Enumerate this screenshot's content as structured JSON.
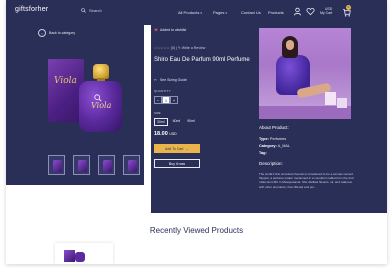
{
  "nav": {
    "logo": "giftsforher",
    "search_placeholder": "Search",
    "menu": [
      {
        "label": "All Products"
      },
      {
        "label": "Pages"
      },
      {
        "label": "Contact Us"
      },
      {
        "label": "Products"
      }
    ],
    "cart_currency": "USD",
    "cart_label": "My Cart",
    "cart_count": "0"
  },
  "product": {
    "back_label": "Back to category",
    "wishlist_label": "Added to wishlist",
    "rating_text": "(0)",
    "write_review": "Write a Review",
    "title": "Shiro Eau De Parfum 90ml Perfume",
    "size_guide": "See Sizing Guide",
    "quantity_label": "QUANTITY",
    "quantity_value": "1",
    "size_label": "SIZE",
    "sizes": [
      "30ml",
      "60ml",
      "90ml"
    ],
    "price": "18.00",
    "currency": "USD",
    "add_to_cart": "Add To Cart",
    "buy_now": "Buy it now",
    "box_text": "Viola",
    "bottle_text": "Viola"
  },
  "about": {
    "heading": "About Product:",
    "type_label": "Type:",
    "type_value": "Perfumes",
    "category_label": "Category:",
    "category_value": "A_MAL",
    "tag_label": "Tag:",
    "tag_value": "",
    "description_heading": "Description:",
    "description": "The world's first recorded chemist is considered to be a woman named Tapputi, a perfume maker mentioned in a cuneiform tablet from the 2nd millennium BC in Mesopotamia. She distilled flowers, oil, and calamus with other aromatics, then filtered and put..."
  },
  "recent": {
    "heading": "Recently Viewed Products"
  },
  "colors": {
    "navy": "#2a2f58",
    "gold": "#e9b44c"
  }
}
